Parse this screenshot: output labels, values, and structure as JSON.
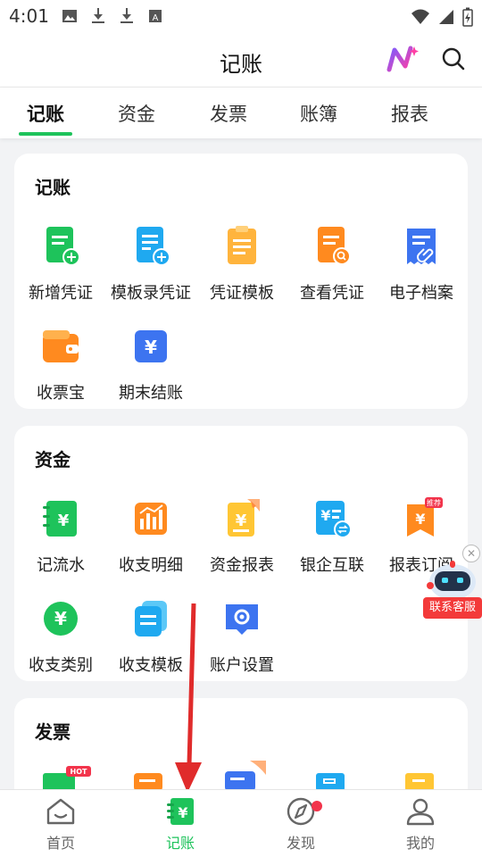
{
  "status_bar": {
    "time": "4:01"
  },
  "header": {
    "title": "记账"
  },
  "tabs": [
    {
      "label": "记账",
      "active": true
    },
    {
      "label": "资金",
      "active": false
    },
    {
      "label": "发票",
      "active": false
    },
    {
      "label": "账簿",
      "active": false
    },
    {
      "label": "报表",
      "active": false
    }
  ],
  "sections": [
    {
      "title": "记账",
      "items": [
        {
          "label": "新增凭证",
          "icon": "new-voucher-icon"
        },
        {
          "label": "模板录凭证",
          "icon": "template-voucher-icon"
        },
        {
          "label": "凭证模板",
          "icon": "voucher-template-icon"
        },
        {
          "label": "查看凭证",
          "icon": "view-voucher-icon"
        },
        {
          "label": "电子档案",
          "icon": "e-archive-icon"
        },
        {
          "label": "收票宝",
          "icon": "wallet-icon"
        },
        {
          "label": "期末结账",
          "icon": "period-close-icon"
        }
      ]
    },
    {
      "title": "资金",
      "items": [
        {
          "label": "记流水",
          "icon": "cash-flow-icon"
        },
        {
          "label": "收支明细",
          "icon": "income-detail-icon"
        },
        {
          "label": "资金报表",
          "icon": "fund-report-icon"
        },
        {
          "label": "银企互联",
          "icon": "bank-link-icon"
        },
        {
          "label": "报表订阅",
          "icon": "report-subscribe-icon",
          "badge": "推荐"
        },
        {
          "label": "收支类别",
          "icon": "category-icon"
        },
        {
          "label": "收支模板",
          "icon": "income-template-icon"
        },
        {
          "label": "账户设置",
          "icon": "account-settings-icon"
        }
      ]
    },
    {
      "title": "发票",
      "items": [
        {
          "label": "",
          "icon": "invoice-icon",
          "badge": "HOT"
        }
      ]
    }
  ],
  "floating_service": {
    "label": "联系客服"
  },
  "bottom_nav": [
    {
      "label": "首页",
      "icon": "home-icon",
      "active": false
    },
    {
      "label": "记账",
      "icon": "ledger-icon",
      "active": true
    },
    {
      "label": "发现",
      "icon": "compass-icon",
      "active": false
    },
    {
      "label": "我的",
      "icon": "profile-icon",
      "active": false
    }
  ],
  "colors": {
    "accent": "#1ec35b",
    "blue": "#2f7bf3",
    "orange": "#ff8a1f",
    "red": "#f2344b"
  }
}
